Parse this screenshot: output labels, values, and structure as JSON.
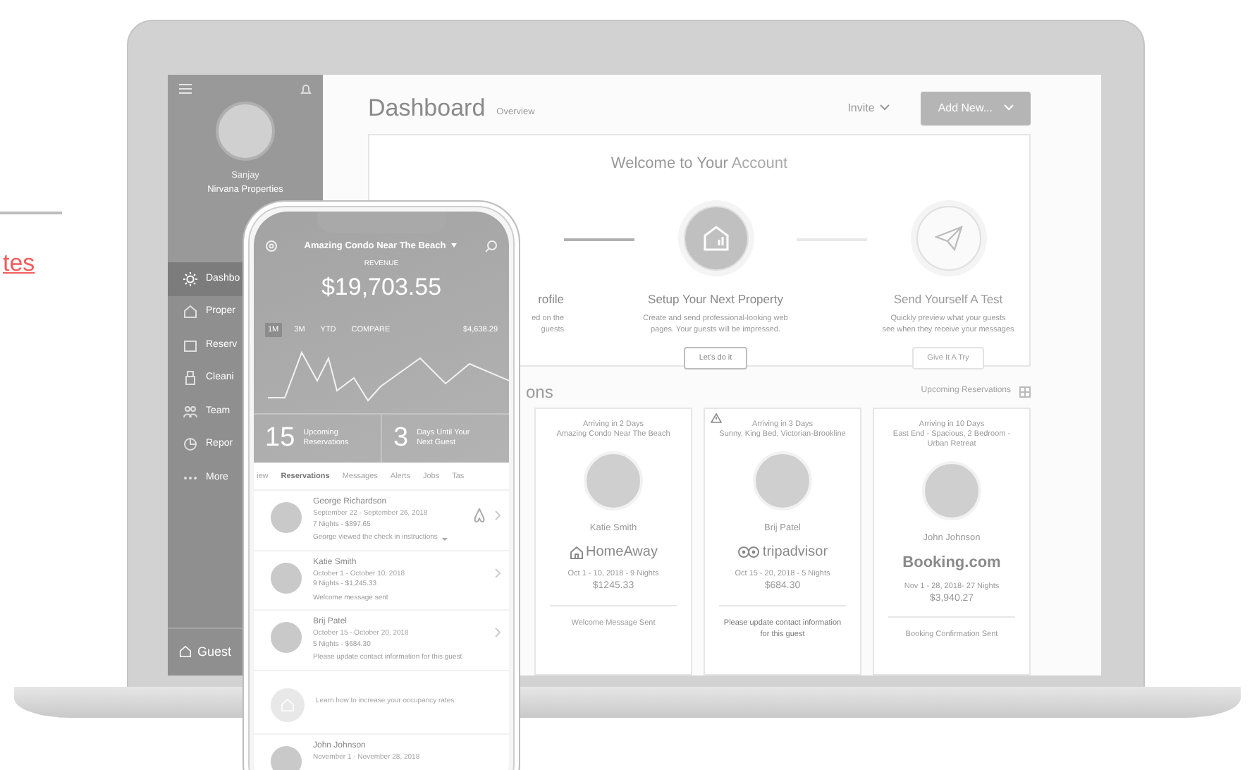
{
  "page": {
    "link": "tes"
  },
  "laptop": {
    "sidebar": {
      "user_name": "Sanjay",
      "company": "Nirvana Properties",
      "items": [
        {
          "label": "Dashbo",
          "selected": true
        },
        {
          "label": "Proper",
          "selected": false
        },
        {
          "label": "Reserv",
          "selected": false
        },
        {
          "label": "Cleani",
          "selected": false
        },
        {
          "label": "Team",
          "selected": false
        },
        {
          "label": "Repor",
          "selected": false
        },
        {
          "label": "More",
          "selected": false
        }
      ],
      "footer": "Guest"
    },
    "header": {
      "title": "Dashboard",
      "subtitle": "Overview",
      "invite": "Invite",
      "add_button": "Add New..."
    },
    "welcome": {
      "title_start": "Welcome to Your ",
      "title_end": "Account",
      "steps": [
        {
          "title": "rofile",
          "description": "ed on the\nguests"
        },
        {
          "title": "Setup Your Next Property",
          "description": "Create and send professional-looking web\npages. Your guests will be impressed.",
          "button": "Let's do it",
          "active": true
        },
        {
          "title": "Send Yourself A Test",
          "description": "Quickly preview what your guests\nsee when they receive your messages",
          "button": "Give It A Try",
          "active": false
        }
      ]
    },
    "reservations": {
      "heading": "ons",
      "filter": "Upcoming Reservations",
      "cards": [
        {
          "arrival": "Arriving in 2 Days",
          "property": "Amazing Condo Near The Beach",
          "guest": "Katie Smith",
          "source_label": "HomeAway",
          "dates": "Oct 1 - 10, 2018 - 9 Nights",
          "amount": "$1245.33",
          "status": "Welcome Message Sent",
          "warning": false
        },
        {
          "arrival": "Arriving in 3 Days",
          "property": "Sunny, King Bed, Victorian-Brookline",
          "guest": "Brij Patel",
          "source_label": "tripadvisor",
          "dates": "Oct 15 - 20, 2018 - 5 Nights",
          "amount": "$684.30",
          "status": "Please update contact information for this guest",
          "warning": true
        },
        {
          "arrival": "Arriving in 10 Days",
          "property": "East End - Spacious, 2 Bedroom - Urban Retreat",
          "guest": "John Johnson",
          "source_label": "Booking.com",
          "dates": "Nov 1 - 28, 2018- 27 Nights",
          "amount": "$3,940.27",
          "status": "Booking Confirmation Sent",
          "warning": false
        }
      ]
    }
  },
  "phone": {
    "property": "Amazing Condo Near The Beach",
    "revenue_label": "REVENUE",
    "revenue": "$19,703.55",
    "periods": [
      {
        "label": "1M",
        "selected": true
      },
      {
        "label": "3M",
        "selected": false
      },
      {
        "label": "YTD",
        "selected": false
      },
      {
        "label": "COMPARE",
        "selected": false
      }
    ],
    "period_total": "$4,638.29",
    "stats": [
      {
        "value": "15",
        "label": "Upcoming\nReservations"
      },
      {
        "value": "3",
        "label": "Days Until Your\nNext Guest"
      }
    ],
    "tabs": [
      {
        "label": "iew",
        "selected": false
      },
      {
        "label": "Reservations",
        "selected": true
      },
      {
        "label": "Messages",
        "selected": false
      },
      {
        "label": "Alerts",
        "selected": false
      },
      {
        "label": "Jobs",
        "selected": false
      },
      {
        "label": "Tas",
        "selected": false
      }
    ],
    "items": [
      {
        "kind": "reservation",
        "name": "George Richardson",
        "dates": "September 22 - September 26, 2018",
        "nights": "7 Nights - $897.65",
        "note": "George viewed the check in instructions"
      },
      {
        "kind": "reservation",
        "name": "Katie Smith",
        "dates": "October 1 - October 10, 2018",
        "nights": "9 Nights - $1,245.33",
        "note": "Welcome message sent"
      },
      {
        "kind": "reservation",
        "name": "Brij Patel",
        "dates": "October 15 - October 20, 2018",
        "nights": "5 Nights - $684.30",
        "note": "Please update contact information for this guest"
      },
      {
        "kind": "tip",
        "note": "Learn how to increase your occupancy rates"
      },
      {
        "kind": "reservation",
        "name": "John Johnson",
        "dates": "November 1 - November 28, 2018"
      }
    ]
  }
}
